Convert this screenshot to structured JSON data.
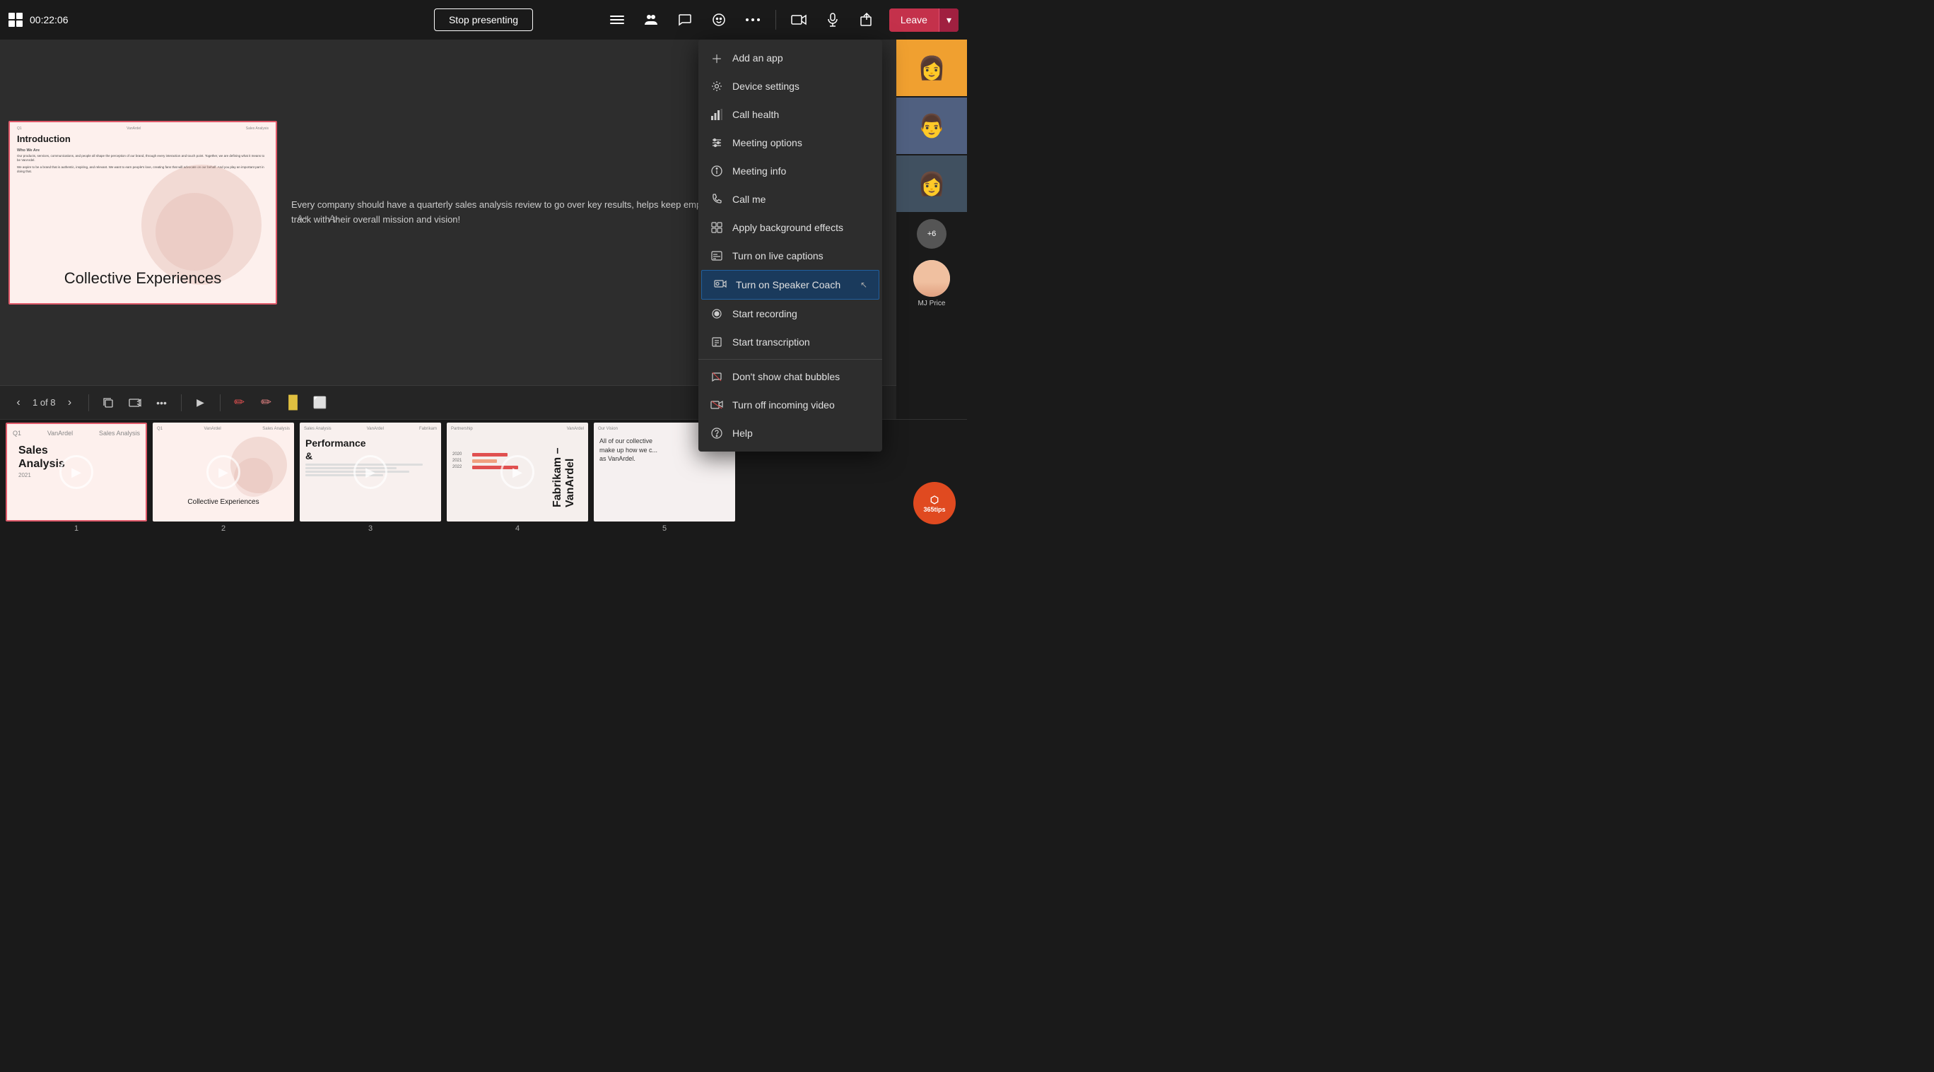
{
  "topbar": {
    "timer": "00:22:06",
    "stop_presenting": "Stop presenting",
    "leave_label": "Leave"
  },
  "notes": {
    "text": "Every company should have a quarterly sales analysis review to go over key results, helps keep employees motivated, and everyone stay on track with their overall mission and vision!"
  },
  "slide": {
    "current": "1",
    "total": "8",
    "slide_label": "1 of 8",
    "title": "Introduction",
    "who_we_are": "Who We Are",
    "body1": "Our products, services, communications, and people all shape the perception of our brand, through every interaction and touch point. Together, we are defining what it means to be VanArdel.",
    "body2": "We aspire to be a brand that is authentic, inspiring, and relevant. We want to earn people's love, creating fans that will advocate on our behalf. And you play an important part in doing that.",
    "big_text": "Collective Experiences",
    "header_left": "Q1",
    "header_center": "VanArdel",
    "header_right": "Sales Analysis"
  },
  "participants": {
    "more_count": "+6",
    "mj_name": "MJ Price"
  },
  "thumbnails": [
    {
      "num": "1",
      "title": "Sales\nAnalysis",
      "year": "2021",
      "type": "sales",
      "active": true
    },
    {
      "num": "2",
      "subtitle": "Collective Experiences",
      "type": "collective",
      "active": false
    },
    {
      "num": "3",
      "title": "Performance\n&",
      "type": "performance",
      "active": false
    },
    {
      "num": "4",
      "type": "partnership",
      "active": false
    },
    {
      "num": "5",
      "title": "All of our collective\nmake up how we c...\nas VanArdel.",
      "type": "vision",
      "active": false
    }
  ],
  "dropdown": {
    "items": [
      {
        "id": "add-app",
        "label": "Add an app",
        "icon": "plus"
      },
      {
        "id": "device-settings",
        "label": "Device settings",
        "icon": "gear"
      },
      {
        "id": "call-health",
        "label": "Call health",
        "icon": "signal"
      },
      {
        "id": "meeting-options",
        "label": "Meeting options",
        "icon": "sliders"
      },
      {
        "id": "meeting-info",
        "label": "Meeting info",
        "icon": "info"
      },
      {
        "id": "call-me",
        "label": "Call me",
        "icon": "phone"
      },
      {
        "id": "background-effects",
        "label": "Apply background effects",
        "icon": "effects"
      },
      {
        "id": "live-captions",
        "label": "Turn on live captions",
        "icon": "captions"
      },
      {
        "id": "speaker-coach",
        "label": "Turn on Speaker Coach",
        "icon": "coach",
        "highlighted": true
      },
      {
        "id": "start-recording",
        "label": "Start recording",
        "icon": "record"
      },
      {
        "id": "start-transcription",
        "label": "Start transcription",
        "icon": "transcription"
      },
      {
        "id": "no-chat-bubbles",
        "label": "Don't show chat bubbles",
        "icon": "no-chat"
      },
      {
        "id": "turn-off-video",
        "label": "Turn off incoming video",
        "icon": "no-video"
      },
      {
        "id": "help",
        "label": "Help",
        "icon": "help"
      }
    ]
  },
  "o365": {
    "label": "365tips"
  }
}
